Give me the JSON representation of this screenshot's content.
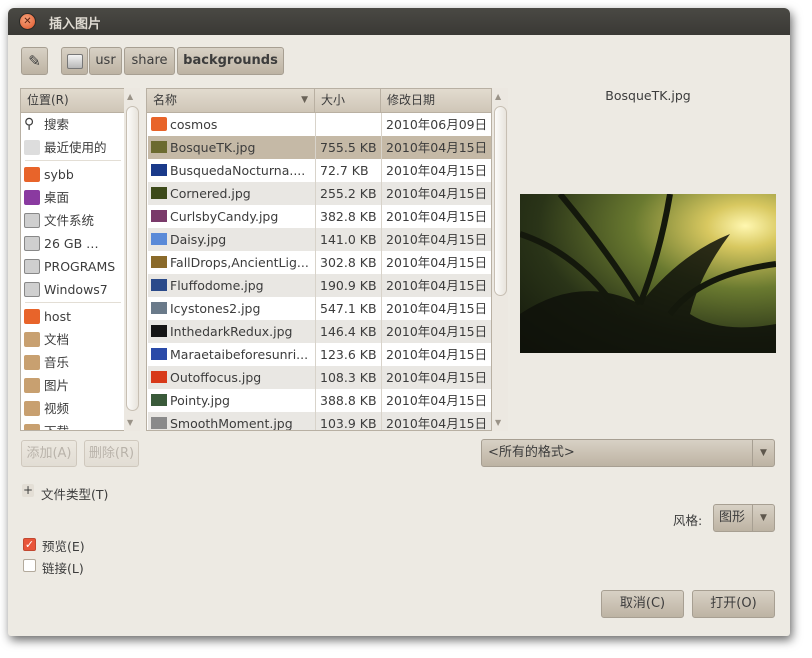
{
  "window": {
    "title": "插入图片"
  },
  "pathbar": {
    "segments": [
      "usr",
      "share",
      "backgrounds"
    ]
  },
  "places": {
    "header": "位置(R)",
    "items": [
      {
        "label": "搜索",
        "icon": "search-icon"
      },
      {
        "label": "最近使用的",
        "icon": "clock-icon"
      },
      {
        "label": "sybb",
        "icon": "home-folder-icon"
      },
      {
        "label": "桌面",
        "icon": "desktop-icon"
      },
      {
        "label": "文件系统",
        "icon": "drive-icon"
      },
      {
        "label": "26 GB …",
        "icon": "drive-icon"
      },
      {
        "label": "PROGRAMS",
        "icon": "drive-icon"
      },
      {
        "label": "Windows7",
        "icon": "drive-icon"
      },
      {
        "label": "host",
        "icon": "folder-icon"
      },
      {
        "label": "文档",
        "icon": "documents-folder-icon"
      },
      {
        "label": "音乐",
        "icon": "music-folder-icon"
      },
      {
        "label": "图片",
        "icon": "pictures-folder-icon"
      },
      {
        "label": "视频",
        "icon": "videos-folder-icon"
      },
      {
        "label": "下载",
        "icon": "downloads-folder-icon"
      }
    ],
    "add_label": "添加(A)",
    "remove_label": "删除(R)"
  },
  "files": {
    "columns": [
      "名称",
      "大小",
      "修改日期"
    ],
    "selected": "BosqueTK.jpg",
    "rows": [
      {
        "name": "cosmos",
        "size": "",
        "date": "2010年06月09日",
        "color": "#e8642a"
      },
      {
        "name": "BosqueTK.jpg",
        "size": "755.5 KB",
        "date": "2010年04月15日",
        "color": "#6b6a30"
      },
      {
        "name": "BusquedaNocturna....",
        "size": "72.7 KB",
        "date": "2010年04月15日",
        "color": "#1a3a8a"
      },
      {
        "name": "Cornered.jpg",
        "size": "255.2 KB",
        "date": "2010年04月15日",
        "color": "#3d4a1a"
      },
      {
        "name": "CurlsbyCandy.jpg",
        "size": "382.8 KB",
        "date": "2010年04月15日",
        "color": "#7a3a6a"
      },
      {
        "name": "Daisy.jpg",
        "size": "141.0 KB",
        "date": "2010年04月15日",
        "color": "#5a8ad8"
      },
      {
        "name": "FallDrops,AncientLig...",
        "size": "302.8 KB",
        "date": "2010年04月15日",
        "color": "#8a6a2a"
      },
      {
        "name": "Fluffodome.jpg",
        "size": "190.9 KB",
        "date": "2010年04月15日",
        "color": "#2a4a8a"
      },
      {
        "name": "Icystones2.jpg",
        "size": "547.1 KB",
        "date": "2010年04月15日",
        "color": "#6a7a8a"
      },
      {
        "name": "InthedarkRedux.jpg",
        "size": "146.4 KB",
        "date": "2010年04月15日",
        "color": "#151515"
      },
      {
        "name": "Maraetaibeforesunri...",
        "size": "123.6 KB",
        "date": "2010年04月15日",
        "color": "#2a4aa8"
      },
      {
        "name": "Outoffocus.jpg",
        "size": "108.3 KB",
        "date": "2010年04月15日",
        "color": "#d83a1a"
      },
      {
        "name": "Pointy.jpg",
        "size": "388.8 KB",
        "date": "2010年04月15日",
        "color": "#3a5a3a"
      },
      {
        "name": "SmoothMoment.jpg",
        "size": "103.9 KB",
        "date": "2010年04月15日",
        "color": "#8a8a8a"
      }
    ]
  },
  "preview": {
    "filename": "BosqueTK.jpg"
  },
  "filter": {
    "selected": "<所有的格式>"
  },
  "expander": {
    "label": "文件类型(T)"
  },
  "style": {
    "label": "风格:",
    "selected": "图形"
  },
  "options": {
    "preview_label": "预览(E)",
    "preview_checked": true,
    "link_label": "链接(L)",
    "link_checked": false
  },
  "actions": {
    "cancel": "取消(C)",
    "open": "打开(O)"
  }
}
